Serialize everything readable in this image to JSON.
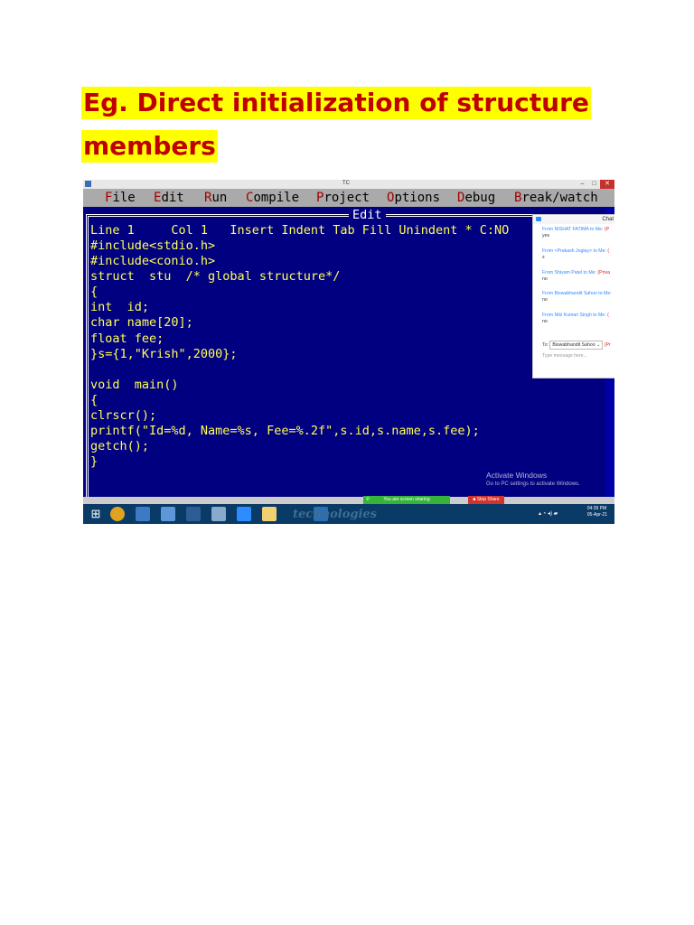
{
  "heading": {
    "line1": "Eg. Direct initialization of structure",
    "line2": "members"
  },
  "screenshot": {
    "window_title": "TC",
    "window_controls": [
      "–",
      "□",
      "✕"
    ],
    "menu": [
      "File",
      "Edit",
      "Run",
      "Compile",
      "Project",
      "Options",
      "Debug",
      "Break/watch"
    ],
    "editor_title": "Edit",
    "status_line": "Line 1     Col 1   Insert Indent Tab Fill Unindent * C:NO",
    "code_lines": [
      "#include<stdio.h>",
      "#include<conio.h>",
      "struct  stu  /* global structure*/",
      "{",
      "int  id;",
      "char name[20];",
      "float fee;",
      "}s={1,\"Krish\",2000};",
      "",
      "void  main()",
      "{",
      "clrscr();",
      "printf(\"Id=%d, Name=%s, Fee=%.2f\",s.id,s.name,s.fee);",
      "getch();",
      "}"
    ],
    "activate_windows": {
      "title": "Activate Windows",
      "subtitle": "Go to PC settings to activate Windows."
    },
    "share_bar": {
      "status": "You are screen sharing",
      "stop": "Stop Share"
    },
    "taskbar": {
      "brand_text": "technologies",
      "time": "04:39 PM",
      "date": "05-Apr-21"
    },
    "chat": {
      "title": "Chat",
      "messages": [
        {
          "from": "From NISHAT FATIMA to Me:",
          "tag": "(P",
          "text": "yes"
        },
        {
          "from": "From <Prakash Joglay> to Me:",
          "tag": "(",
          "text": "s"
        },
        {
          "from": "From Shivam Patel to Me:",
          "tag": "(Priva",
          "text": "no"
        },
        {
          "from": "From Biswabhandit Sahoo to Me:",
          "tag": "",
          "text": "no"
        },
        {
          "from": "From Niki Kumari Singh to Me:",
          "tag": "(",
          "text": "no"
        }
      ],
      "to_label": "To:",
      "to_value": "Biswabhandit Sahoo ⌄",
      "to_tag": "(Pr",
      "input_placeholder": "Type message here..."
    }
  }
}
